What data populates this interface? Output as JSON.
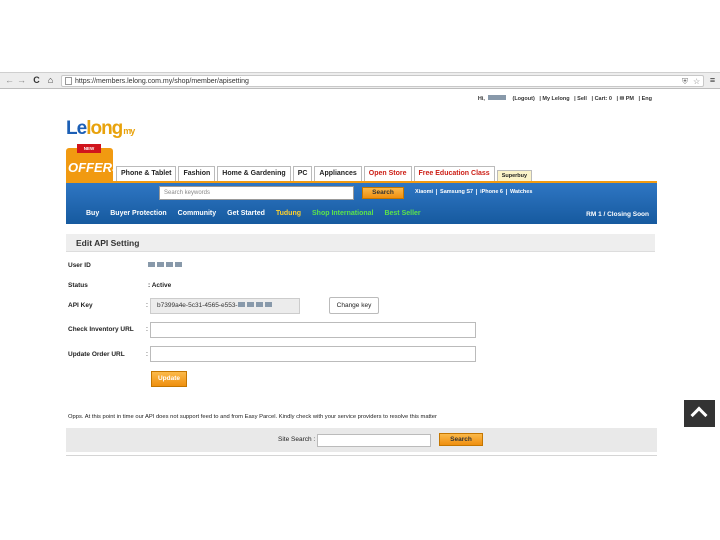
{
  "browser": {
    "url": "https://members.lelong.com.my/shop/member/apisetting",
    "back": "←",
    "forward": "→",
    "reload": "C",
    "home": "⌂",
    "menu": "≡"
  },
  "header": {
    "greeting": "Hi,",
    "links": [
      "(Logout)",
      "| My Lelong",
      "| Sell",
      "| Cart: 0",
      "| ✉ PM",
      "| Eng"
    ],
    "logo_main": "Le",
    "logo_accent": "long",
    "logo_suffix": "my"
  },
  "offers": {
    "badge": "NEW",
    "label": "OFFERS"
  },
  "tabs": [
    {
      "label": "Phone & Tablet",
      "style": "normal"
    },
    {
      "label": "Fashion",
      "style": "normal"
    },
    {
      "label": "Home & Gardening",
      "style": "normal"
    },
    {
      "label": "PC",
      "style": "normal"
    },
    {
      "label": "Appliances",
      "style": "normal"
    },
    {
      "label": "Open Store",
      "style": "red"
    },
    {
      "label": "Free Education Class",
      "style": "red"
    },
    {
      "label": "Superbuy",
      "style": "small"
    }
  ],
  "search": {
    "placeholder": "Search keywords",
    "button": "Search",
    "quick_links": [
      "Xiaomi",
      "Samsung S7",
      "iPhone 6",
      "Watches"
    ]
  },
  "menu": [
    {
      "label": "Buy",
      "color": "white"
    },
    {
      "label": "Buyer Protection",
      "color": "white"
    },
    {
      "label": "Community",
      "color": "white"
    },
    {
      "label": "Get Started",
      "color": "white"
    },
    {
      "label": "Tudung",
      "color": "yellow"
    },
    {
      "label": "Shop International",
      "color": "green"
    },
    {
      "label": "Best Seller",
      "color": "green"
    }
  ],
  "rm_text": "RM 1  /  Closing Soon",
  "panel": {
    "title": "Edit API Setting",
    "user_id_label": "User ID",
    "status_label": "Status",
    "status_value": ": Active",
    "api_key_label": "API Key",
    "api_key_value": "b7399a4e-5c31-4565-e553-",
    "change_key": "Change key",
    "inventory_label": "Check Inventory URL",
    "order_label": "Update Order URL",
    "colon": ":",
    "inventory_value": "",
    "order_value": "",
    "update_button": "Update"
  },
  "notice": "Opps. At this point in time our API does not support feed to and from Easy Parcel. Kindly check with your service providers to resolve this matter",
  "site_search": {
    "label": "Site Search :",
    "button": "Search",
    "value": ""
  },
  "colors": {
    "blue": "#1c5fb5",
    "orange": "#f19a11",
    "red": "#cc1d14"
  }
}
